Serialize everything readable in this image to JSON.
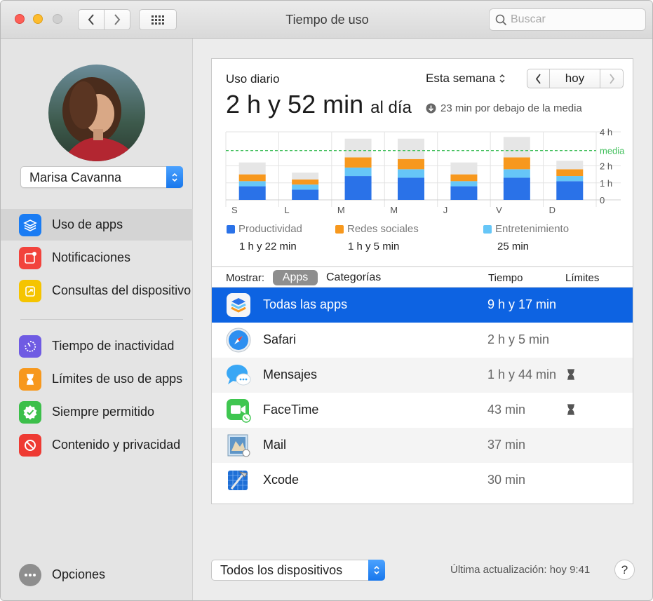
{
  "window": {
    "title": "Tiempo de uso",
    "search_placeholder": "Buscar"
  },
  "sidebar": {
    "user": "Marisa Cavanna",
    "items": [
      {
        "label": "Uso de apps",
        "icon": "layers-icon",
        "color": "#1a7cf3",
        "active": true
      },
      {
        "label": "Notificaciones",
        "icon": "notification-icon",
        "color": "#f2433c",
        "active": false
      },
      {
        "label": "Consultas del dispositivo",
        "icon": "pickup-icon",
        "color": "#f5c400",
        "active": false
      },
      {
        "label": "Tiempo de inactividad",
        "icon": "downtime-icon",
        "color": "#6f5be3",
        "active": false
      },
      {
        "label": "Límites de uso de apps",
        "icon": "hourglass-icon",
        "color": "#f7981d",
        "active": false
      },
      {
        "label": "Siempre permitido",
        "icon": "check-badge-icon",
        "color": "#3cbf4a",
        "active": false
      },
      {
        "label": "Contenido y privacidad",
        "icon": "restricted-icon",
        "color": "#ee3a33",
        "active": false
      }
    ],
    "options_label": "Opciones"
  },
  "summary": {
    "label": "Uso diario",
    "value": "2 h y 52 min",
    "value_suffix": "al día",
    "comparison": "23 min por debajo de la media",
    "period": "Esta semana",
    "today": "hoy"
  },
  "chart_data": {
    "type": "bar",
    "stacked": true,
    "categories": [
      "S",
      "L",
      "M",
      "M",
      "J",
      "V",
      "D"
    ],
    "series": [
      {
        "name": "Productividad",
        "color": "#2a72e8",
        "values": [
          0.8,
          0.6,
          1.4,
          1.3,
          0.8,
          1.3,
          1.1
        ]
      },
      {
        "name": "Entretenimiento",
        "color": "#66c6f7",
        "values": [
          0.3,
          0.3,
          0.5,
          0.5,
          0.3,
          0.5,
          0.3
        ]
      },
      {
        "name": "Redes sociales",
        "color": "#f7981d",
        "values": [
          0.4,
          0.3,
          0.6,
          0.6,
          0.4,
          0.7,
          0.4
        ]
      },
      {
        "name": "",
        "color": "#e6e6e6",
        "values": [
          0.7,
          0.4,
          1.1,
          1.2,
          0.7,
          1.2,
          0.5
        ]
      }
    ],
    "yticks": [
      "4 h",
      "2 h",
      "1 h",
      "0"
    ],
    "ylim": [
      0,
      4
    ],
    "average_label": "media",
    "average_value": 2.9,
    "legend": [
      {
        "name": "Productividad",
        "color": "#2a72e8",
        "total": "1 h y 22 min"
      },
      {
        "name": "Redes sociales",
        "color": "#f7981d",
        "total": "1 h y 5 min"
      },
      {
        "name": "Entretenimiento",
        "color": "#66c6f7",
        "total": "25 min"
      }
    ]
  },
  "table": {
    "show_label": "Mostrar:",
    "tab_apps": "Apps",
    "tab_categories": "Categorías",
    "col_time": "Tiempo",
    "col_limits": "Límites",
    "rows": [
      {
        "name": "Todas las apps",
        "time": "9 h y 17 min",
        "icon": "all-apps-icon",
        "limit": false,
        "selected": true
      },
      {
        "name": "Safari",
        "time": "2 h y 5 min",
        "icon": "safari-icon",
        "limit": false,
        "selected": false
      },
      {
        "name": "Mensajes",
        "time": "1 h y 44 min",
        "icon": "messages-icon",
        "limit": true,
        "selected": false
      },
      {
        "name": "FaceTime",
        "time": "43 min",
        "icon": "facetime-icon",
        "limit": true,
        "selected": false
      },
      {
        "name": "Mail",
        "time": "37 min",
        "icon": "mail-icon",
        "limit": false,
        "selected": false
      },
      {
        "name": "Xcode",
        "time": "30 min",
        "icon": "xcode-icon",
        "limit": false,
        "selected": false
      }
    ]
  },
  "footer": {
    "device": "Todos los dispositivos",
    "last_update": "Última actualización: hoy 9:41",
    "help": "?"
  }
}
